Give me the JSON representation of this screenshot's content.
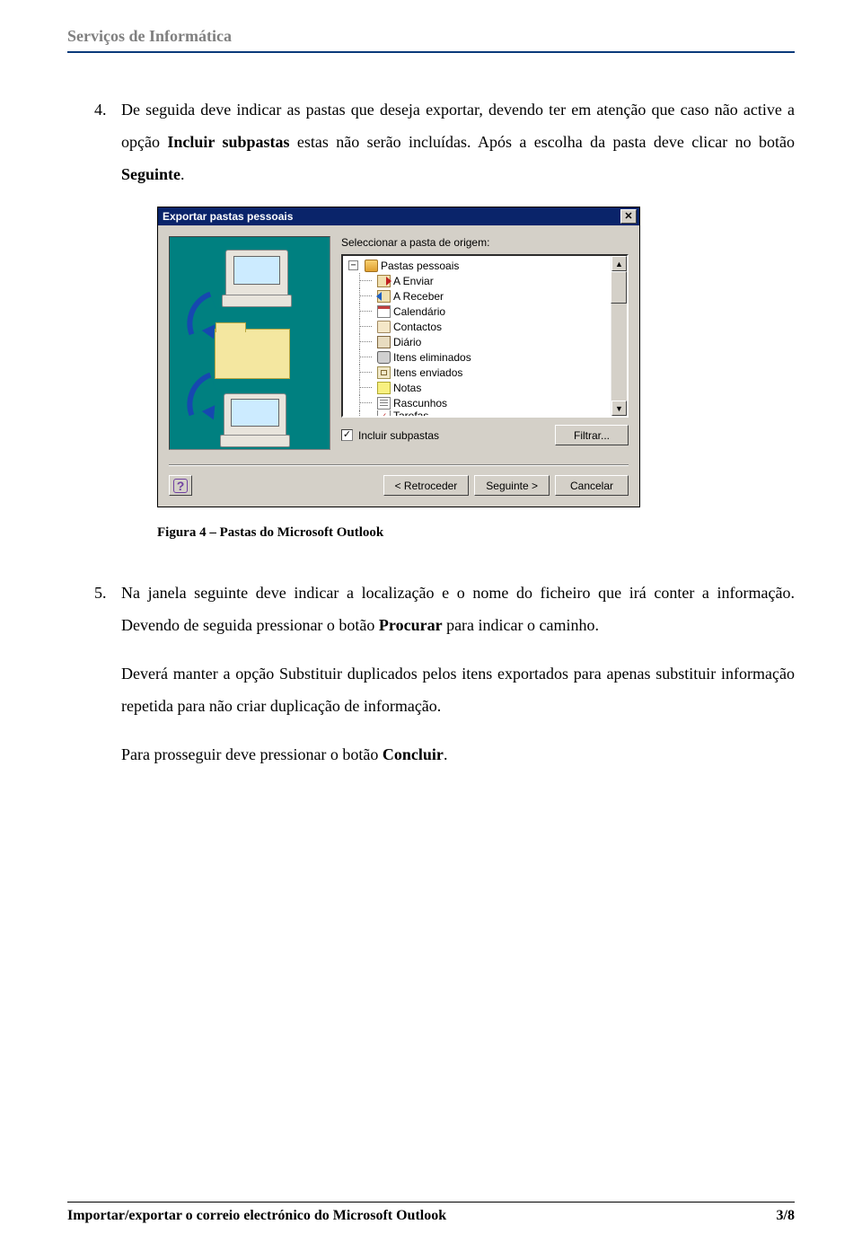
{
  "header": {
    "title": "Serviços de Informática"
  },
  "para1": {
    "num": "4.",
    "t1": "De seguida deve indicar as pastas que deseja exportar, devendo ter em atenção que caso não active a opção ",
    "b1": "Incluir subpastas",
    "t2": " estas não serão incluídas. Após a escolha da pasta deve clicar no botão ",
    "b2": "Seguinte",
    "t3": "."
  },
  "dialog": {
    "title": "Exportar pastas pessoais",
    "prompt": "Seleccionar a pasta de origem:",
    "expander": "−",
    "tree": {
      "root": "Pastas pessoais",
      "items": [
        "A Enviar",
        "A Receber",
        "Calendário",
        "Contactos",
        "Diário",
        "Itens eliminados",
        "Itens enviados",
        "Notas",
        "Rascunhos",
        "Tarefas"
      ]
    },
    "checkbox_mark": "✓",
    "checkbox_label": "Incluir subpastas",
    "filter_btn": "Filtrar...",
    "back_btn": "< Retroceder",
    "next_btn": "Seguinte >",
    "cancel_btn": "Cancelar",
    "close_glyph": "✕",
    "help_glyph": "?",
    "scroll_up": "▲",
    "scroll_down": "▼"
  },
  "caption": "Figura 4 – Pastas do Microsoft Outlook",
  "para2": {
    "num": "5.",
    "t1": "Na janela seguinte deve indicar a localização e o nome do ficheiro que irá conter a informação. Devendo de seguida pressionar o botão ",
    "b1": "Procurar",
    "t2": " para indicar o caminho."
  },
  "para3": "Deverá manter a opção Substituir duplicados pelos itens exportados para apenas substituir informação repetida para não criar duplicação de informação.",
  "para4": {
    "t1": "Para prosseguir deve pressionar o botão ",
    "b1": "Concluir",
    "t2": "."
  },
  "footer": {
    "left": "Importar/exportar o correio electrónico do Microsoft Outlook",
    "right": "3/8"
  }
}
